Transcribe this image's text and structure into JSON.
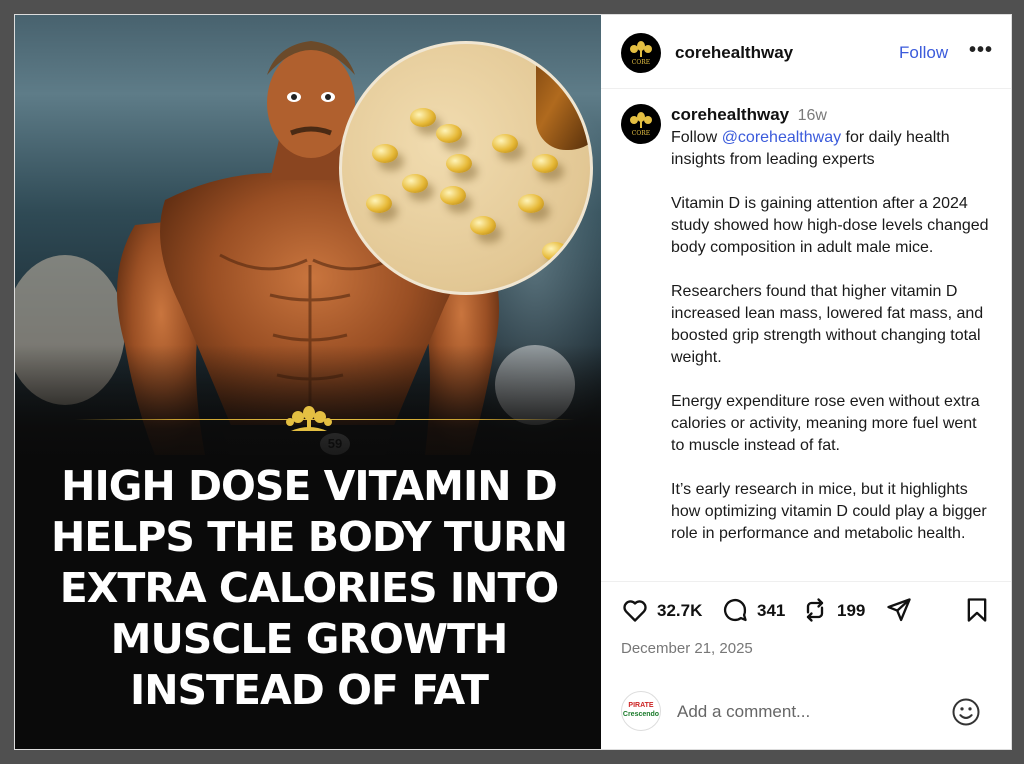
{
  "post": {
    "image_headline": "HIGH DOSE VITAMIN D HELPS THE BODY TURN EXTRA CALORIES INTO MUSCLE GROWTH INSTEAD OF FAT",
    "jersey_number": "59"
  },
  "header": {
    "username": "corehealthway",
    "avatar_text": "CORE",
    "follow_label": "Follow",
    "more_label": "•••"
  },
  "caption": {
    "username": "corehealthway",
    "age": "16w",
    "line1_prefix": "Follow ",
    "mention": "@corehealthway",
    "line1_suffix": " for daily health insights from leading experts",
    "p2": "Vitamin D is gaining attention after a 2024 study showed how high-dose levels changed body composition in adult male mice.",
    "p3": "Researchers found that higher vitamin D increased lean mass, lowered fat mass, and boosted grip strength without changing total weight.",
    "p4": "Energy expenditure rose even without extra calories or activity, meaning more fuel went to muscle instead of fat.",
    "p5": "It’s early research in mice, but it highlights how optimizing vitamin D could play a bigger role in performance and metabolic health."
  },
  "actions": {
    "likes": "32.7K",
    "comments": "341",
    "reposts": "199",
    "date": "December 21, 2025"
  },
  "comment": {
    "placeholder": "Add a comment...",
    "avatar_text_top": "PIRATE",
    "avatar_text_bottom": "Crescendo"
  },
  "colors": {
    "accent": "#3b5bdb",
    "gold": "#e4bf42"
  },
  "icons": [
    "heart-icon",
    "comment-icon",
    "repost-icon",
    "share-icon",
    "bookmark-icon",
    "emoji-icon"
  ]
}
